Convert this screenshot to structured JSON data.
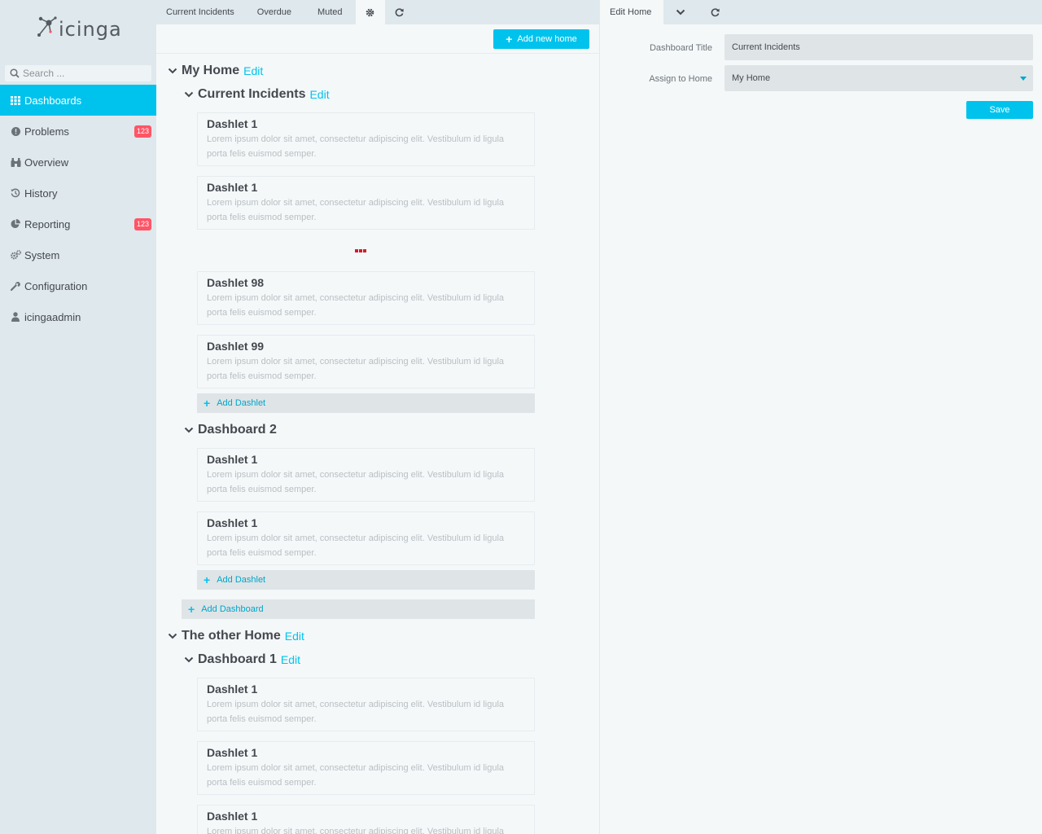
{
  "app": {
    "logo_text": "icinga"
  },
  "sidebar": {
    "search_placeholder": "Search ...",
    "items": [
      {
        "label": "Dashboards",
        "icon": "grid-icon"
      },
      {
        "label": "Problems",
        "icon": "alert-circle-icon",
        "badge": "123"
      },
      {
        "label": "Overview",
        "icon": "binoculars-icon"
      },
      {
        "label": "History",
        "icon": "history-icon"
      },
      {
        "label": "Reporting",
        "icon": "pie-chart-icon",
        "badge": "123"
      },
      {
        "label": "System",
        "icon": "gears-icon"
      },
      {
        "label": "Configuration",
        "icon": "wrench-icon"
      },
      {
        "label": "icingaadmin",
        "icon": "user-icon"
      }
    ]
  },
  "main": {
    "tabs": [
      {
        "label": "Current Incidents"
      },
      {
        "label": "Overdue"
      },
      {
        "label": "Muted"
      }
    ],
    "add_home_label": "Add new home",
    "edit_label": "Edit",
    "add_dashlet_label": "Add Dashlet",
    "add_dashboard_label": "Add Dashboard",
    "lorem": "Lorem ipsum dolor sit amet, consectetur adipiscing elit. Vestibulum id ligula porta felis euismod semper.",
    "homes": [
      {
        "title": "My Home",
        "dashboards": [
          {
            "title": "Current Incidents",
            "dashlets": [
              "Dashlet 1",
              "Dashlet 1",
              "Dashlet 98",
              "Dashlet 99"
            ]
          },
          {
            "title": "Dashboard 2",
            "dashlets": [
              "Dashlet 1",
              "Dashlet 1"
            ]
          }
        ]
      },
      {
        "title": "The other Home",
        "dashboards": [
          {
            "title": "Dashboard 1",
            "dashlets": [
              "Dashlet 1",
              "Dashlet 1",
              "Dashlet 1"
            ]
          }
        ]
      }
    ]
  },
  "right": {
    "tab_label": "Edit Home",
    "form": {
      "title_label": "Dashboard Title",
      "title_value": "Current Incidents",
      "home_label": "Assign to Home",
      "home_value": "My Home",
      "save_label": "Save"
    }
  },
  "colors": {
    "accent": "#00c3ed",
    "badge": "#ff5566",
    "sidebar": "#dfe8ec"
  }
}
